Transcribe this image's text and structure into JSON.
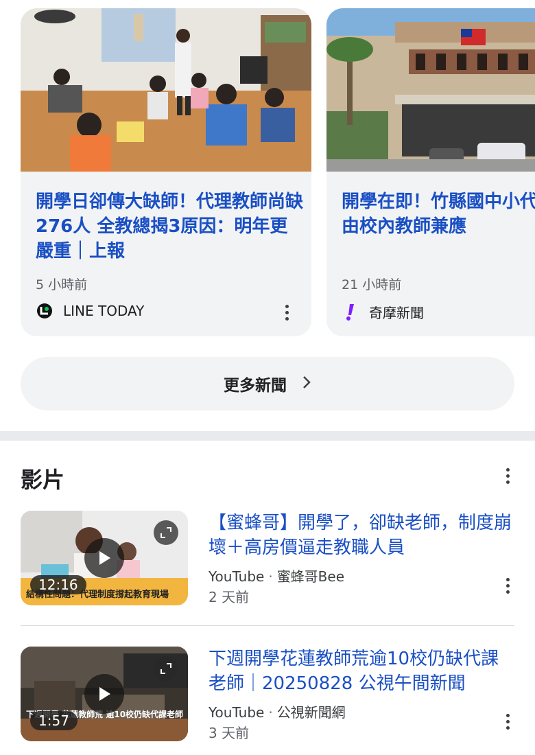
{
  "news": {
    "cards": [
      {
        "title": "開學日卻傳大缺師！代理教師尚缺276人 全教總揭3原因：明年更嚴重｜上報",
        "time": "5 小時前",
        "source": "LINE TODAY",
        "source_icon": "line-today-logo"
      },
      {
        "title": "開學在即！竹縣國中小代理教師 由校內教師兼應",
        "time": "21 小時前",
        "source": "奇摩新聞",
        "source_icon": "yahoo-news-logo"
      }
    ],
    "more_label": "更多新聞"
  },
  "videos": {
    "section_title": "影片",
    "items": [
      {
        "title": "【蜜蜂哥】開學了，卻缺老師，制度崩壞＋高房價逼走教職人員",
        "platform": "YouTube",
        "channel": "蜜蜂哥Bee",
        "time": "2 天前",
        "duration": "12:16",
        "caption": "結構性問題：代理制度撐起教育現場"
      },
      {
        "title": "下週開學花蓮教師荒逾10校仍缺代課老師｜20250828 公視午間新聞",
        "platform": "YouTube",
        "channel": "公視新聞網",
        "time": "3 天前",
        "duration": "1:57",
        "caption": "下週開學 花蓮教師荒 逾10校仍缺代課老師"
      }
    ]
  },
  "colors": {
    "link_blue": "#1a4fc4",
    "card_bg": "#f1f3f4",
    "line_green": "#06c755",
    "yahoo_purple": "#7e1fff"
  }
}
